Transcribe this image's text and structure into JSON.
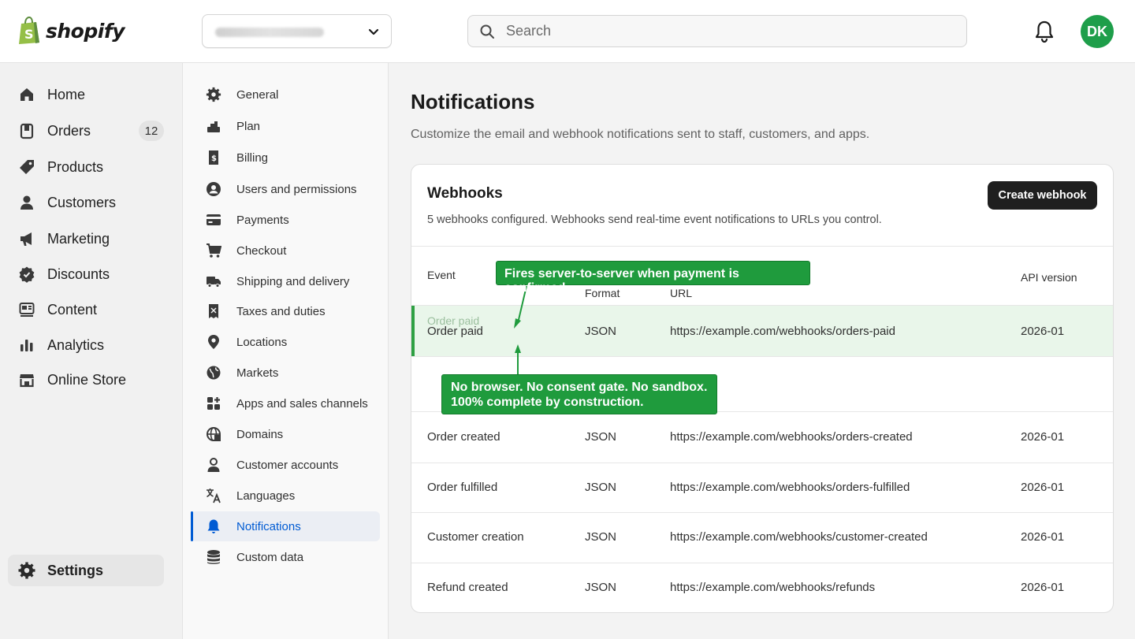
{
  "brand": {
    "logo_text": "shopify"
  },
  "topbar": {
    "search_placeholder": "Search",
    "avatar_initials": "DK"
  },
  "left_nav": {
    "items": [
      {
        "label": "Home",
        "icon": "home-icon"
      },
      {
        "label": "Orders",
        "icon": "orders-icon",
        "badge": "12"
      },
      {
        "label": "Products",
        "icon": "tag-icon"
      },
      {
        "label": "Customers",
        "icon": "person-icon"
      },
      {
        "label": "Marketing",
        "icon": "megaphone-icon"
      },
      {
        "label": "Discounts",
        "icon": "discount-icon"
      },
      {
        "label": "Content",
        "icon": "content-icon"
      },
      {
        "label": "Analytics",
        "icon": "bar-chart-icon"
      },
      {
        "label": "Online Store",
        "icon": "store-icon"
      }
    ],
    "settings_label": "Settings"
  },
  "settings_nav": {
    "items": [
      {
        "label": "General"
      },
      {
        "label": "Plan"
      },
      {
        "label": "Billing"
      },
      {
        "label": "Users and permissions"
      },
      {
        "label": "Payments"
      },
      {
        "label": "Checkout"
      },
      {
        "label": "Shipping and delivery"
      },
      {
        "label": "Taxes and duties"
      },
      {
        "label": "Locations"
      },
      {
        "label": "Markets"
      },
      {
        "label": "Apps and sales channels"
      },
      {
        "label": "Domains"
      },
      {
        "label": "Customer accounts"
      },
      {
        "label": "Languages"
      },
      {
        "label": "Notifications",
        "active": true
      },
      {
        "label": "Custom data"
      }
    ]
  },
  "main": {
    "title": "Notifications",
    "subtitle": "Customize the email and webhook notifications sent to staff, customers, and apps.",
    "webhooks": {
      "title": "Webhooks",
      "description": "5 webhooks configured. Webhooks send real-time event notifications to URLs you control.",
      "create_label": "Create webhook",
      "columns": {
        "event": "Event",
        "format": "Format",
        "url": "URL",
        "api_version": "API version"
      },
      "rows": [
        {
          "event": "Order paid",
          "format": "JSON",
          "url": "https://example.com/webhooks/orders-paid",
          "api_version": "2026-01",
          "highlighted": true
        },
        {
          "event": "Order created",
          "format": "JSON",
          "url": "https://example.com/webhooks/orders-created",
          "api_version": "2026-01"
        },
        {
          "event": "Order fulfilled",
          "format": "JSON",
          "url": "https://example.com/webhooks/orders-fulfilled",
          "api_version": "2026-01"
        },
        {
          "event": "Customer creation",
          "format": "JSON",
          "url": "https://example.com/webhooks/customer-created",
          "api_version": "2026-01"
        },
        {
          "event": "Refund created",
          "format": "JSON",
          "url": "https://example.com/webhooks/refunds",
          "api_version": "2026-01"
        }
      ]
    }
  },
  "annotations": {
    "top": "Fires server-to-server when payment is confirmed.",
    "bottom_line1": "No browser. No consent gate. No sandbox.",
    "bottom_line2": "100% complete by construction."
  },
  "colors": {
    "accent_blue": "#005bd3",
    "annotation_green": "#1f9b3d",
    "avatar_green": "#1e9e4a",
    "highlight_row": "#e9f6ea"
  }
}
